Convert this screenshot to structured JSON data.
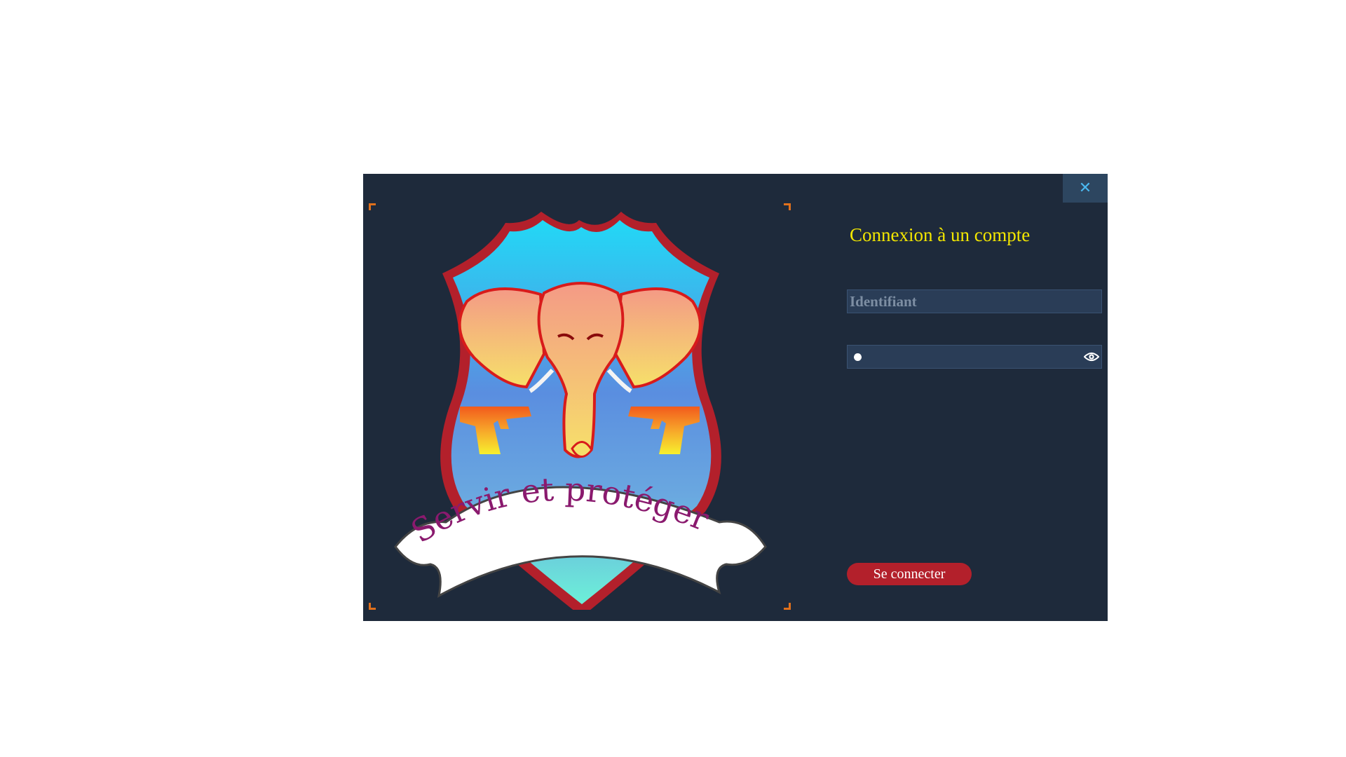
{
  "dialog": {
    "title": "Connexion à un compte",
    "close_label": "✕"
  },
  "emblem": {
    "motto": "Servir et protéger",
    "icon": "elephant-pistols-shield-logo"
  },
  "form": {
    "username_placeholder": "Identifiant",
    "username_value": "",
    "password_masked_chars": 1,
    "password_toggle_icon": "eye-icon",
    "submit_label": "Se connecter"
  },
  "colors": {
    "background": "#1e2a3b",
    "title": "#f2e600",
    "field_bg": "#2a3d57",
    "button": "#b3202b",
    "close_bg": "#2d4660",
    "close_icon": "#4ab8f0",
    "frame_corners": "#e0701c",
    "shield_border": "#b3202b"
  }
}
